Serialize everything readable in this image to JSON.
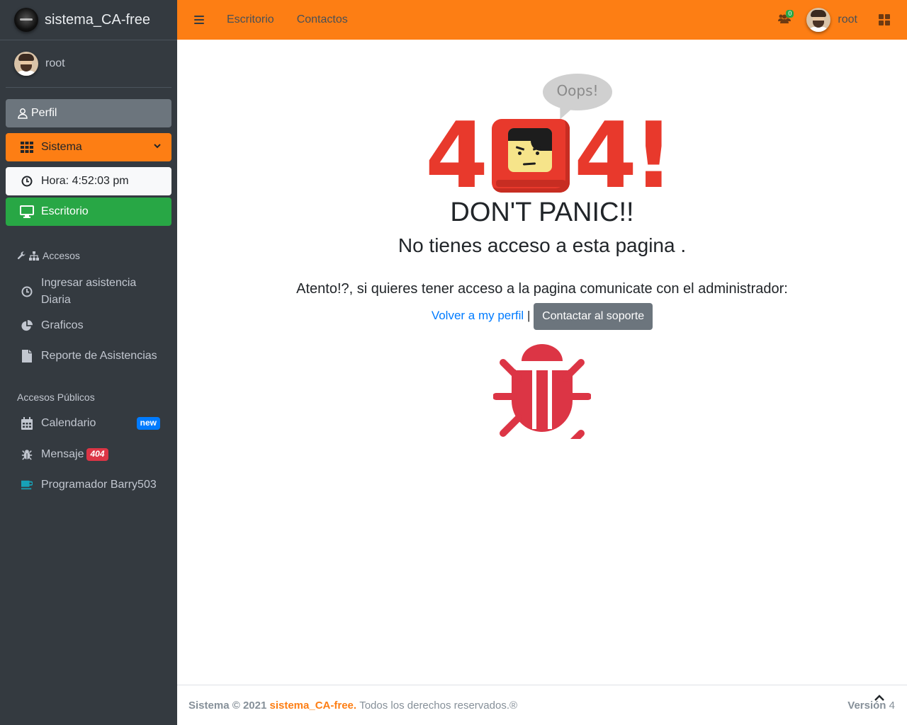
{
  "brand": {
    "name": "sistema_CA-free"
  },
  "user": {
    "name": "root"
  },
  "sidebar": {
    "perfil_label": "Perfil",
    "sistema_label": "Sistema",
    "hora_label": "Hora: 4:52:03 pm",
    "escritorio_label": "Escritorio",
    "section_accesos": "Accesos",
    "accesos_items": [
      {
        "label": "Ingresar asistencia Diaria",
        "icon": "clock-icon"
      },
      {
        "label": "Graficos",
        "icon": "pie-chart-icon"
      },
      {
        "label": "Reporte de Asistencias",
        "icon": "file-icon"
      }
    ],
    "section_publicos": "Accesos Públicos",
    "publicos_items": [
      {
        "label": "Calendario",
        "icon": "calendar-icon",
        "badge": "new",
        "badge_color": "#007bff"
      },
      {
        "label": "Mensaje",
        "icon": "bug-icon",
        "badge": "404",
        "badge_color": "#dc3545"
      },
      {
        "label": "Programador Barry503",
        "icon": "coffee-icon"
      }
    ]
  },
  "navbar": {
    "links": [
      "Escritorio",
      "Contactos"
    ],
    "users_count": "0",
    "user_name": "root"
  },
  "error": {
    "bubble": "Oops!",
    "code_left": "4",
    "code_right": "4!",
    "headline": "DON'T PANIC!!",
    "subtitle": "No tienes acceso a esta pagina .",
    "message": "Atento!?, si quieres tener acceso a la pagina comunicate con el administrador:",
    "back_link": "Volver a my perfil",
    "separator": "|",
    "support_button": "Contactar al soporte"
  },
  "footer": {
    "sistema": "Sistema",
    "copyright": "© 2021",
    "brand": "sistema_CA-free.",
    "rights": "Todos los derechos reservados.®",
    "version_label": "Versión",
    "version_number": "4"
  },
  "colors": {
    "sidebar_bg": "#343a40",
    "accent": "#fd7e14",
    "success": "#28a745",
    "danger": "#dc3545",
    "primary": "#007bff",
    "secondary": "#6c757d",
    "error_red": "#e8392c"
  }
}
